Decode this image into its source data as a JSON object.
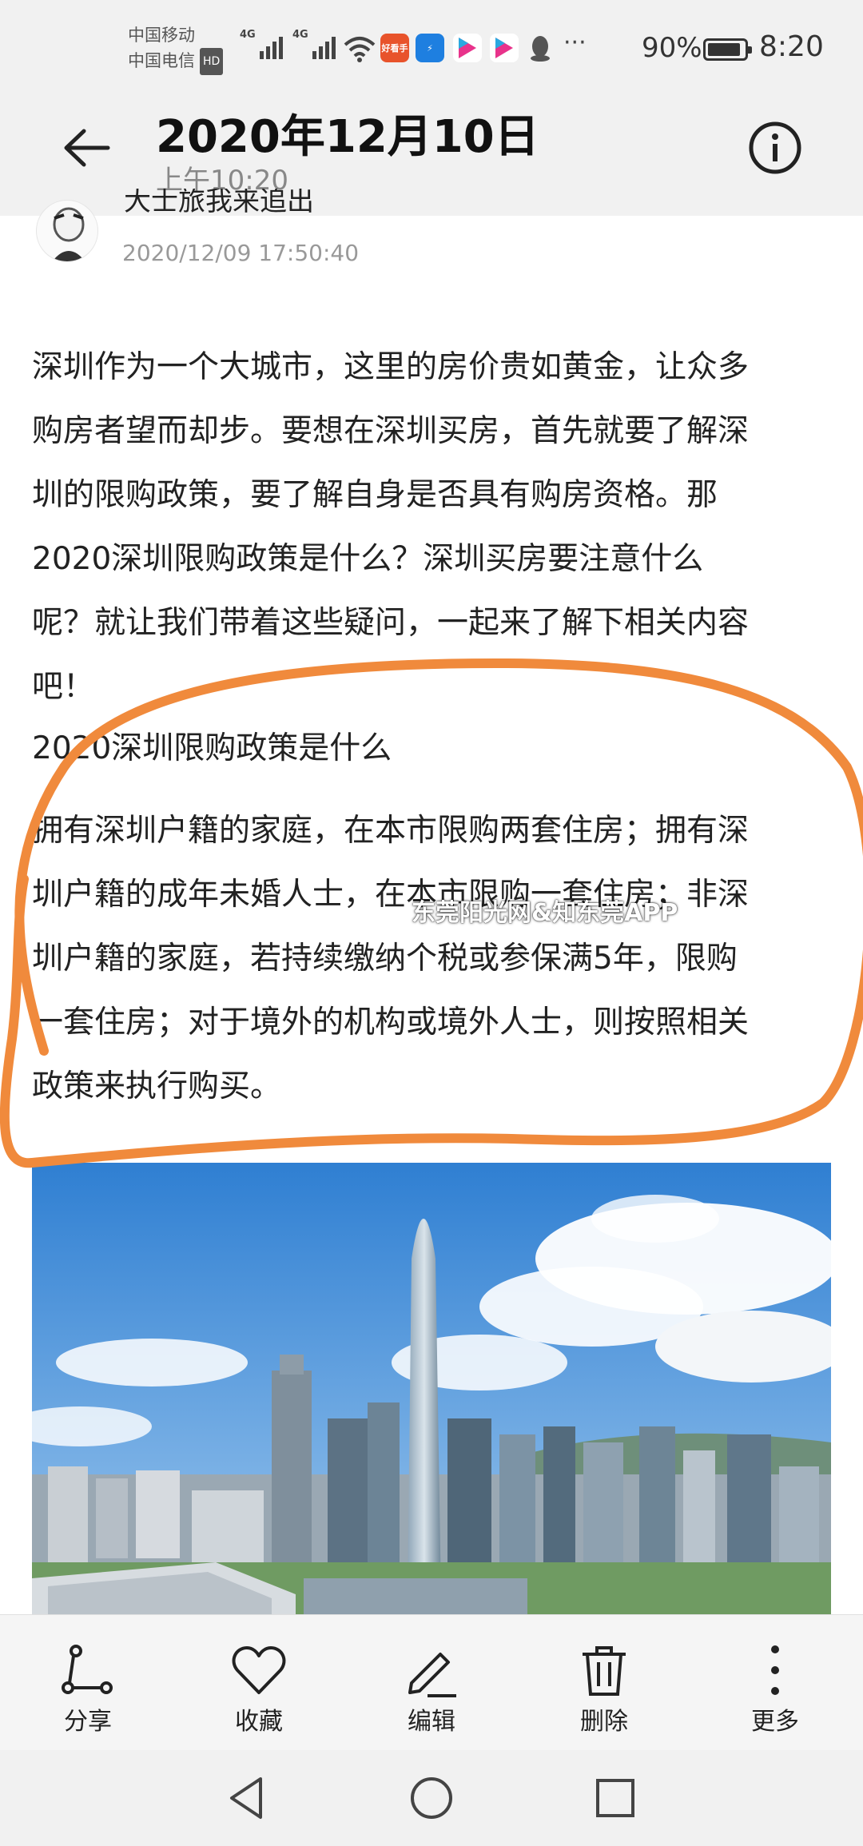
{
  "status_bar": {
    "carrier_1": "中国移动",
    "carrier_2": "中国电信",
    "hd_badge": "HD",
    "signal_1_label": "4G",
    "signal_2_label": "4G",
    "app_icon_1": "好看手",
    "app_icon_2": "YOUKU",
    "app_icon_3": "YOUKU",
    "more": "···",
    "battery_percent": "90%",
    "battery_level": 0.9,
    "time": "8:20"
  },
  "header": {
    "title": "2020年12月10日",
    "subtitle": "上午10:20"
  },
  "post": {
    "author": "大士旅我来追出",
    "timestamp": "2020/12/09 17:50:40"
  },
  "article": {
    "paragraph_lines": [
      "深圳作为一个大城市，这里的房价贵如黄金，让众多",
      "购房者望而却步。要想在深圳买房，首先就要了解深",
      "圳的限购政策，要了解自身是否具有购房资格。那",
      "2020深圳限购政策是什么？深圳买房要注意什么",
      "呢？就让我们带着这些疑问，一起来了解下相关内容",
      "吧！"
    ],
    "heading": "2020深圳限购政策是什么",
    "policy_lines": [
      "拥有深圳户籍的家庭，在本市限购两套住房；拥有深",
      "圳户籍的成年未婚人士，在本市限购一套住房；非深",
      "圳户籍的家庭，若持续缴纳个税或参保满5年，限购",
      "一套住房；对于境外的机构或境外人士，则按照相关",
      "政策来执行购买。"
    ],
    "watermark": "东莞阳光网&知东莞APP"
  },
  "actions": {
    "share": "分享",
    "favorite": "收藏",
    "edit": "编辑",
    "delete": "删除",
    "more": "更多"
  },
  "colors": {
    "annotation": "#f08a3c",
    "sky": "#3f8fd8"
  },
  "icons": [
    "back-arrow-icon",
    "info-icon",
    "share-icon",
    "heart-icon",
    "pencil-icon",
    "trash-icon",
    "more-vertical-icon",
    "nav-back-icon",
    "nav-home-icon",
    "nav-recents-icon"
  ]
}
